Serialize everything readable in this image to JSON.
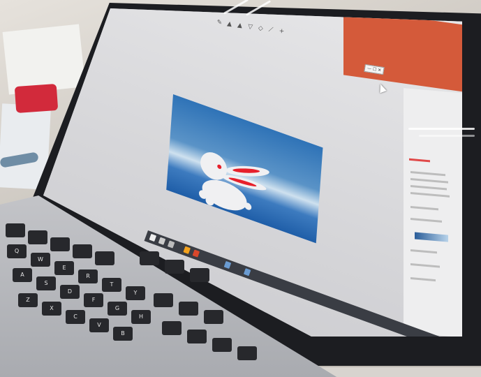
{
  "scene": {
    "description_free": true
  },
  "slide": {
    "shape": "rabbit-illustration",
    "colors": {
      "bg_top": "#2f73b7",
      "bg_bottom": "#1f5ea8",
      "ears_inner": "#e6202b",
      "body": "#f0f0f2"
    }
  },
  "keys": [
    "Q",
    "W",
    "E",
    "R",
    "T",
    "Y",
    "A",
    "S",
    "D",
    "F",
    "G",
    "H",
    "Z",
    "X",
    "C",
    "V",
    "B"
  ]
}
